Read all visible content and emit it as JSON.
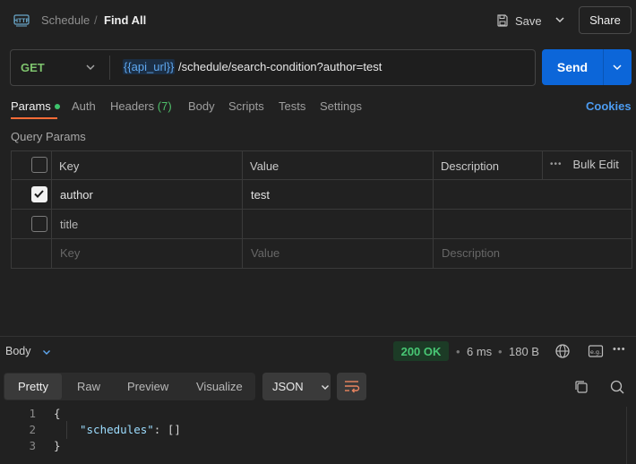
{
  "header": {
    "breadcrumb_collection": "Schedule",
    "breadcrumb_separator": "/",
    "breadcrumb_request": "Find All",
    "save_label": "Save",
    "share_label": "Share"
  },
  "request": {
    "method": "GET",
    "url_variable": "{{api_url}}",
    "url_path": " /schedule/search-condition?author=test",
    "send_label": "Send"
  },
  "tabs": {
    "params": "Params",
    "auth": "Auth",
    "headers": "Headers",
    "headers_count": "(7)",
    "body": "Body",
    "scripts": "Scripts",
    "tests": "Tests",
    "settings": "Settings",
    "cookies": "Cookies"
  },
  "query_params": {
    "section_label": "Query Params",
    "columns": {
      "key": "Key",
      "value": "Value",
      "description": "Description",
      "bulk_edit": "Bulk Edit"
    },
    "rows": [
      {
        "key": "author",
        "value": "test",
        "description": "",
        "checked": true
      },
      {
        "key": "title",
        "value": "",
        "description": "",
        "checked": false
      }
    ],
    "placeholder": {
      "key": "Key",
      "value": "Value",
      "description": "Description"
    }
  },
  "response": {
    "body_label": "Body",
    "status": "200 OK",
    "time": "6 ms",
    "size": "180 B",
    "view_tabs": [
      "Pretty",
      "Raw",
      "Preview",
      "Visualize"
    ],
    "format": "JSON",
    "code_lines": [
      {
        "no": "1",
        "text": "{"
      },
      {
        "no": "2",
        "key": "\"schedules\"",
        "rest": ": []"
      },
      {
        "no": "3",
        "text": "}"
      }
    ]
  },
  "colors": {
    "accent_send": "#0c66d9",
    "method_get": "#7fc46e",
    "status_ok": "#48c774",
    "active_tab_underline": "#ff6c37",
    "link": "#4c9bf0"
  }
}
